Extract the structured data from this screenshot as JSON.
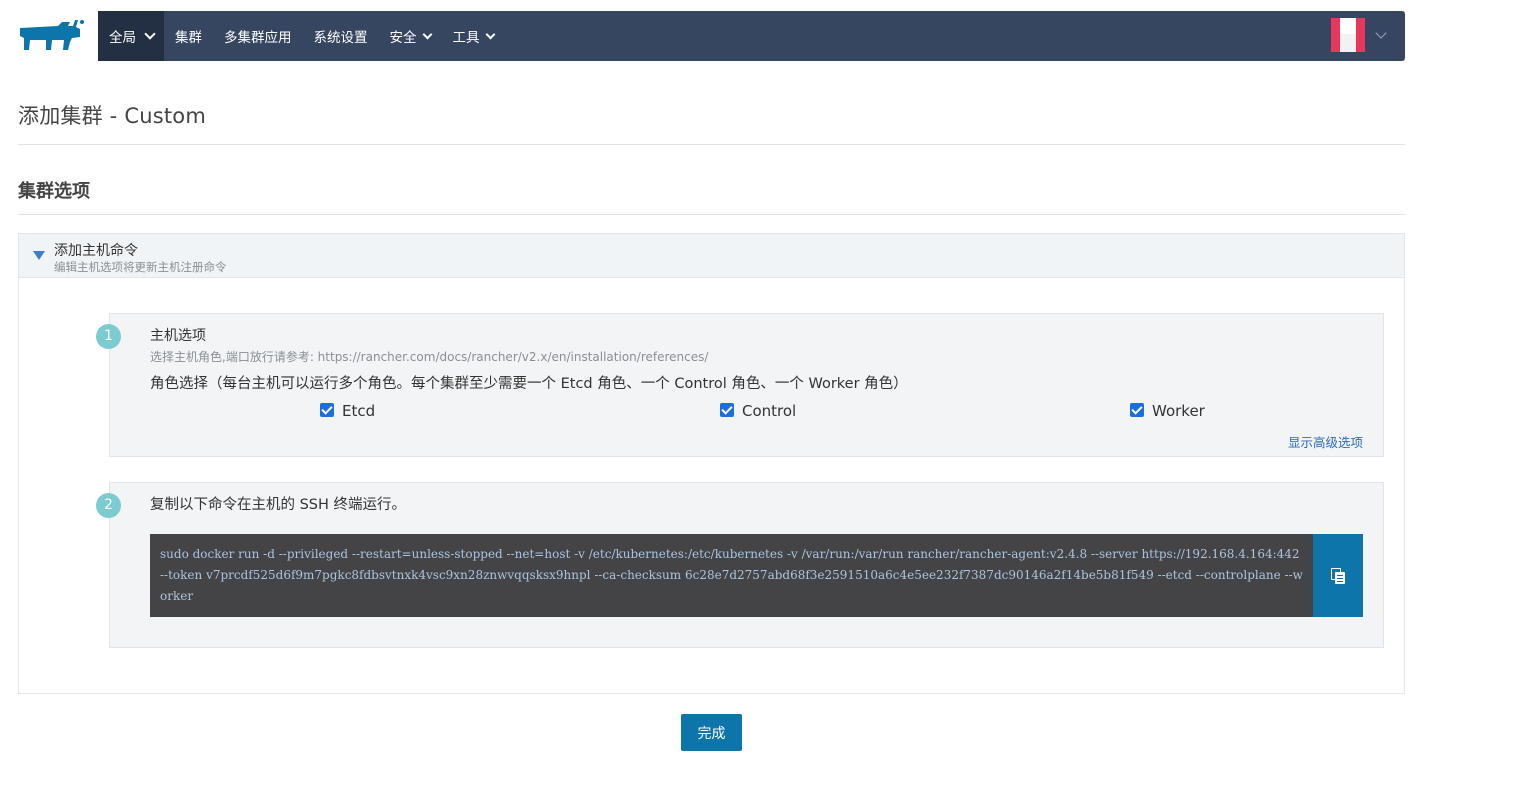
{
  "brand": {
    "logo_icon": "rancher-cow-logo-icon",
    "logo_color": "#0d75aa"
  },
  "nav": {
    "items": [
      {
        "label": "全局",
        "has_dropdown": true,
        "active": true
      },
      {
        "label": "集群",
        "has_dropdown": false
      },
      {
        "label": "多集群应用",
        "has_dropdown": false
      },
      {
        "label": "系统设置",
        "has_dropdown": false
      },
      {
        "label": "安全",
        "has_dropdown": true
      },
      {
        "label": "工具",
        "has_dropdown": true
      }
    ],
    "bar_color": "#364560",
    "active_color": "#232f42"
  },
  "user": {
    "avatar_icon": "user-avatar-icon",
    "menu_icon": "chevron-down-icon"
  },
  "page": {
    "title": "添加集群 - Custom",
    "section_title": "集群选项"
  },
  "accordion": {
    "title": "添加主机命令",
    "subtitle": "编辑主机选项将更新主机注册命令"
  },
  "step1": {
    "number": "1",
    "title": "主机选项",
    "hint": "选择主机角色,端口放行请参考: https://rancher.com/docs/rancher/v2.x/en/installation/references/",
    "roles_label": "角色选择（每台主机可以运行多个角色。每个集群至少需要一个 Etcd 角色、一个 Control 角色、一个 Worker 角色）",
    "roles": [
      {
        "label": "Etcd",
        "checked": true
      },
      {
        "label": "Control",
        "checked": true
      },
      {
        "label": "Worker",
        "checked": true
      }
    ],
    "advanced_link": "显示高级选项"
  },
  "step2": {
    "number": "2",
    "title": "复制以下命令在主机的 SSH 终端运行。",
    "command": "sudo docker run -d --privileged --restart=unless-stopped --net=host -v /etc/kubernetes:/etc/kubernetes -v /var/run:/var/run rancher/rancher-agent:v2.4.8 --server https://192.168.4.164:442 --token v7prcdf525d6f9m7pgkc8fdbsvtnxk4vsc9xn28znwvqqsksx9hnpl --ca-checksum 6c28e7d2757abd68f3e2591510a6c4e5ee232f7387dc90146a2f14be5b81f549 --etcd --controlplane --worker",
    "copy_icon": "clipboard-icon"
  },
  "footer": {
    "done_label": "完成"
  }
}
